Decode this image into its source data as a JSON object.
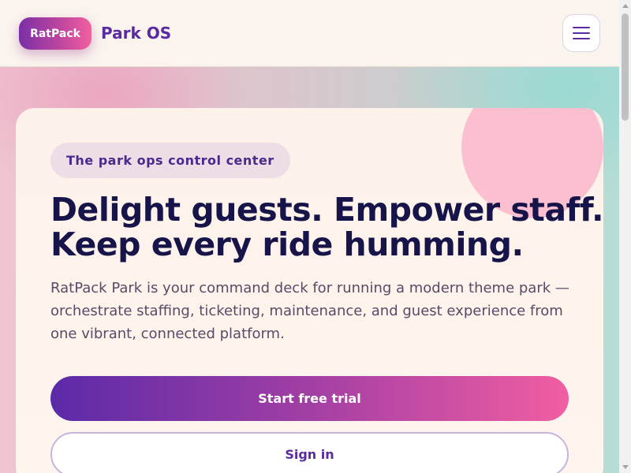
{
  "header": {
    "logo_label": "RatPack",
    "brand_name": "Park OS",
    "menu_icon": "hamburger-menu-icon"
  },
  "hero": {
    "eyebrow": "The park ops control center",
    "headline_line1": "Delight guests. Empower staff.",
    "headline_line2": "Keep every ride humming.",
    "description": "RatPack Park is your command deck for running a modern theme park — orchestrate staffing, ticketing, maintenance, and guest experience from one vibrant, connected platform.",
    "primary_cta": "Start free trial",
    "secondary_cta": "Sign in"
  },
  "colors": {
    "brand_purple": "#5b2aa0",
    "brand_pink": "#f15ea2",
    "headline": "#17144a"
  }
}
